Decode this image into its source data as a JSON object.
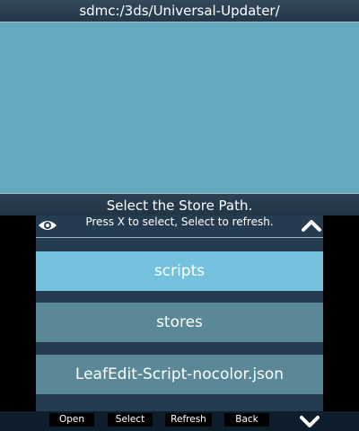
{
  "top_screen": {
    "path": "sdmc:/3ds/Universal-Updater/"
  },
  "prompt": {
    "title": "Select the Store Path.",
    "subtitle": "Press X to select, Select to refresh."
  },
  "list": {
    "items": [
      {
        "label": "scripts",
        "state": "selected"
      },
      {
        "label": "stores",
        "state": "normal"
      },
      {
        "label": "LeafEdit-Script-nocolor.json",
        "state": "normal"
      }
    ]
  },
  "footer": {
    "open_label": "Open",
    "select_label": "Select",
    "refresh_label": "Refresh",
    "back_label": "Back"
  },
  "icons": {
    "eye": "eye-icon",
    "scroll_up": "chevron-up-icon",
    "scroll_down": "chevron-down-icon"
  },
  "colors": {
    "top_background": "#64a9c0",
    "bar_background": "#253c50",
    "item_selected": "#74c1dd",
    "item_normal": "#5a8896"
  }
}
